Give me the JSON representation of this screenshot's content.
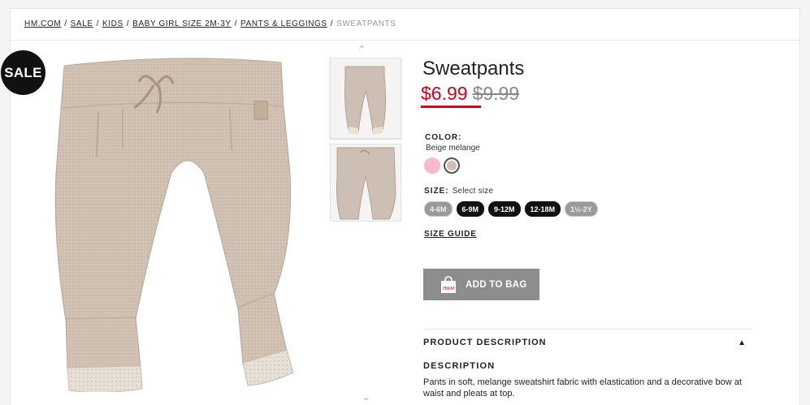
{
  "breadcrumb": {
    "items": [
      "HM.COM",
      "SALE",
      "KIDS",
      "BABY GIRL SIZE 2M-3Y",
      "PANTS & LEGGINGS"
    ],
    "current": "SWEATPANTS"
  },
  "badge": "SALE",
  "product": {
    "title": "Sweatpants",
    "sale_price": "$6.99",
    "original_price": "$9.99"
  },
  "color": {
    "label": "COLOR:",
    "selected_name": "Beige melange",
    "swatches": [
      {
        "name": "Light pink",
        "hex": "#f7b9cd"
      },
      {
        "name": "Beige melange",
        "hex": "#cdbfb3"
      }
    ]
  },
  "size": {
    "label": "SIZE:",
    "prompt": "Select size",
    "options": [
      {
        "label": "4-6M",
        "available": false
      },
      {
        "label": "6-9M",
        "available": true
      },
      {
        "label": "9-12M",
        "available": true
      },
      {
        "label": "12-18M",
        "available": true
      },
      {
        "label": "1½-2Y",
        "available": false
      }
    ]
  },
  "size_guide": "SIZE GUIDE",
  "add_to_bag": "ADD TO BAG",
  "description": {
    "header": "PRODUCT DESCRIPTION",
    "title": "DESCRIPTION",
    "text": "Pants in soft, melange sweatshirt fabric with elastication and a decorative bow at waist and pleats at top."
  },
  "colors": {
    "sale_red": "#d0021b",
    "button_grey": "#8d8d8d",
    "product_beige": "#cdbfb3"
  }
}
